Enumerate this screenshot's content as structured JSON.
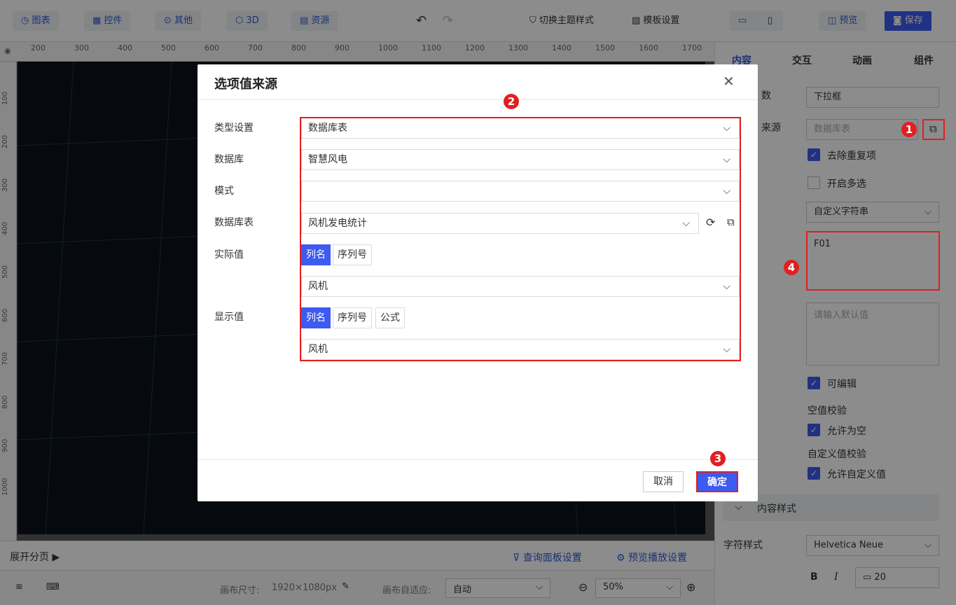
{
  "toolbar": {
    "chart": "图表",
    "control": "控件",
    "other": "其他",
    "three_d": "3D",
    "resource": "资源",
    "theme": "切换主题样式",
    "template": "模板设置",
    "preview": "预览",
    "save": "保存"
  },
  "ruler": {
    "top": [
      "200",
      "300",
      "400",
      "500",
      "600",
      "700",
      "800",
      "900",
      "1000",
      "1100",
      "1200",
      "1300",
      "1400",
      "1500",
      "1600",
      "1700"
    ],
    "left": [
      "100",
      "200",
      "300",
      "400",
      "500",
      "600",
      "700",
      "800",
      "900",
      "1000"
    ]
  },
  "bottom": {
    "expand_pages": "展开分页",
    "query_panel": "查询面板设置",
    "preview_play": "预览播放设置",
    "canvas_size_label": "画布尺寸:",
    "canvas_size": "1920×1080px",
    "adapt_label": "画布自适应:",
    "adapt_value": "自动",
    "zoom": "50%"
  },
  "right_panel": {
    "tabs": [
      "内容",
      "交互",
      "动画",
      "组件"
    ],
    "param_label": "数",
    "param_value": "下拉框",
    "source_label": "来源",
    "source_placeholder": "数据库表",
    "dedup": "去除重复项",
    "multi": "开启多选",
    "custom_type": "自定义字符串",
    "custom_value": "F01",
    "default_placeholder": "请输入默认值",
    "editable": "可编辑",
    "empty_check": "空值校验",
    "allow_empty": "允许为空",
    "custom_check": "自定义值校验",
    "allow_custom": "允许自定义值",
    "content_style": "内容样式",
    "font_style_label": "字符样式",
    "font_family": "Helvetica Neue",
    "bold": "B",
    "italic": "I",
    "font_size": "20"
  },
  "modal": {
    "title": "选项值来源",
    "rows": {
      "type_label": "类型设置",
      "type_value": "数据库表",
      "db_label": "数据库",
      "db_value": "智慧风电",
      "schema_label": "模式",
      "schema_value": "",
      "table_label": "数据库表",
      "table_value": "风机发电统计",
      "actual_label": "实际值",
      "display_label": "显示值",
      "actual_value": "风机",
      "display_value": "风机"
    },
    "seg_actual": [
      "列名",
      "序列号"
    ],
    "seg_display": [
      "列名",
      "序列号",
      "公式"
    ],
    "cancel": "取消",
    "ok": "确定"
  },
  "badges": [
    "1",
    "2",
    "3",
    "4"
  ],
  "colors": {
    "accent": "#3d5af1",
    "highlight": "#e02020"
  }
}
